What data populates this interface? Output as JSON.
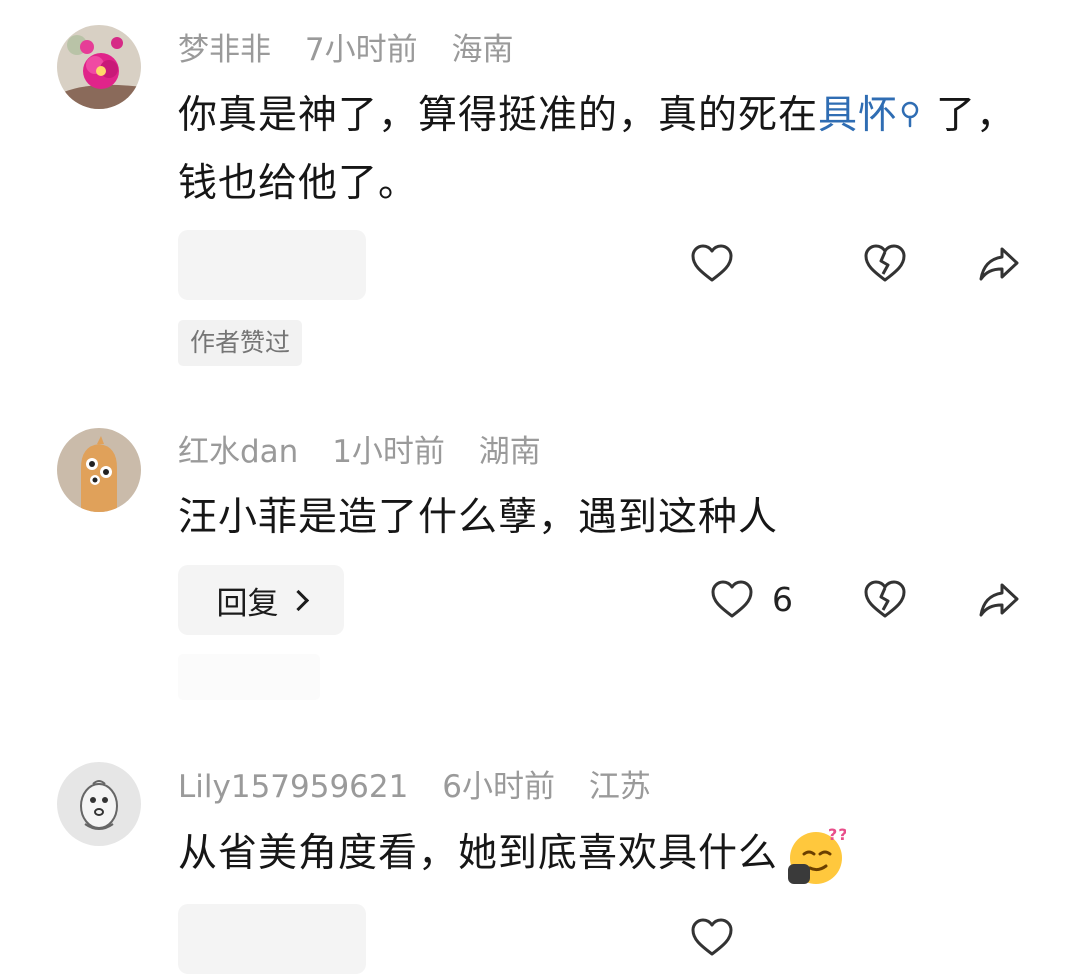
{
  "comments": [
    {
      "username": "梦非非",
      "time": "7小时前",
      "location": "海南",
      "text_part1": "你真是神了，算得挺准的，真的死在",
      "link_text": "具怀",
      "text_part2": "了，钱也给他了。",
      "badge": "作者赞过"
    },
    {
      "username": "红水dan",
      "time": "1小时前",
      "location": "湖南",
      "text": "汪小菲是造了什么孽，遇到这种人",
      "reply_label": "回复",
      "like_count": "6"
    },
    {
      "username": "Lily157959621",
      "time": "6小时前",
      "location": "江苏",
      "text": "从省美角度看，她到底喜欢具什么"
    }
  ],
  "icons": {
    "like": "heart-outline-icon",
    "dislike": "broken-heart-icon",
    "share": "share-arrow-icon",
    "link_search": "search-icon"
  },
  "colors": {
    "link": "#2f6db3",
    "meta": "#9a9a9a",
    "text": "#161616",
    "chip": "#f4f4f4"
  }
}
